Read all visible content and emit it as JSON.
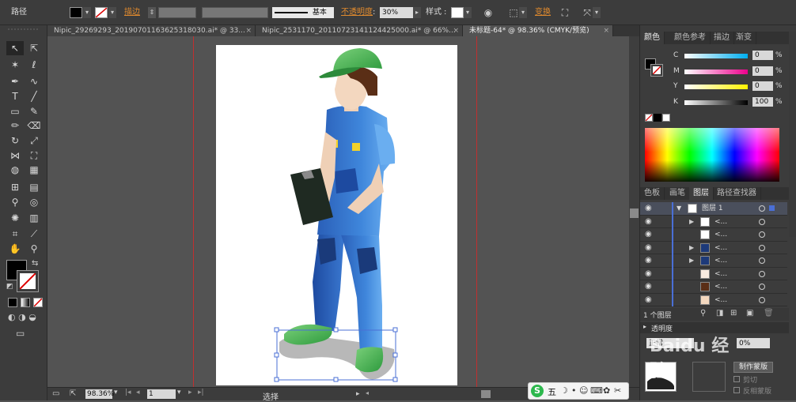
{
  "control_bar": {
    "selection_label": "路径",
    "stroke_label": "描边",
    "stroke_style_label": "基本",
    "opacity_label": "不透明度",
    "opacity_value": "30%",
    "style_label": "样式",
    "transform_label": "变换"
  },
  "tabs": [
    {
      "label": "Nipic_29269293_20190701163625318030.ai* @ 33...",
      "active": false
    },
    {
      "label": "Nipic_2531170_20110723141124425000.ai* @ 66%...",
      "active": false
    },
    {
      "label": "未标题-64* @ 98.36% (CMYK/预览)",
      "active": true
    }
  ],
  "tab_close_glyph": "×",
  "status_bar": {
    "zoom": "98.36%",
    "artboard_number": "1",
    "tool_name": "选择"
  },
  "color_panel": {
    "tabs": [
      "颜色",
      "颜色参考",
      "描边",
      "渐变"
    ],
    "channels": [
      {
        "label": "C",
        "value": "0",
        "unit": "%"
      },
      {
        "label": "M",
        "value": "0",
        "unit": "%"
      },
      {
        "label": "Y",
        "value": "0",
        "unit": "%"
      },
      {
        "label": "K",
        "value": "100",
        "unit": "%"
      }
    ]
  },
  "layers_panel": {
    "tabs": [
      "色板",
      "画笔",
      "图层",
      "路径查找器"
    ],
    "layer_name": "图层 1",
    "sublayer_label": "<...",
    "footer": "1 个图层"
  },
  "transparency_panel": {
    "title": "透明度",
    "blend_mode": "正常",
    "opacity": "0%",
    "make_mask_button": "制作蒙版",
    "clip_label": "剪切",
    "invert_mask_label": "反相蒙版"
  },
  "ime_bar": {
    "mode": "五"
  },
  "watermark": "Baidu 经验",
  "colors": {
    "accent_orange": "#e08a2e",
    "panel_bg": "#3c3c3c",
    "canvas_bg": "#535353",
    "guide_red": "#c03030",
    "selection_blue": "#4a6fd6"
  }
}
